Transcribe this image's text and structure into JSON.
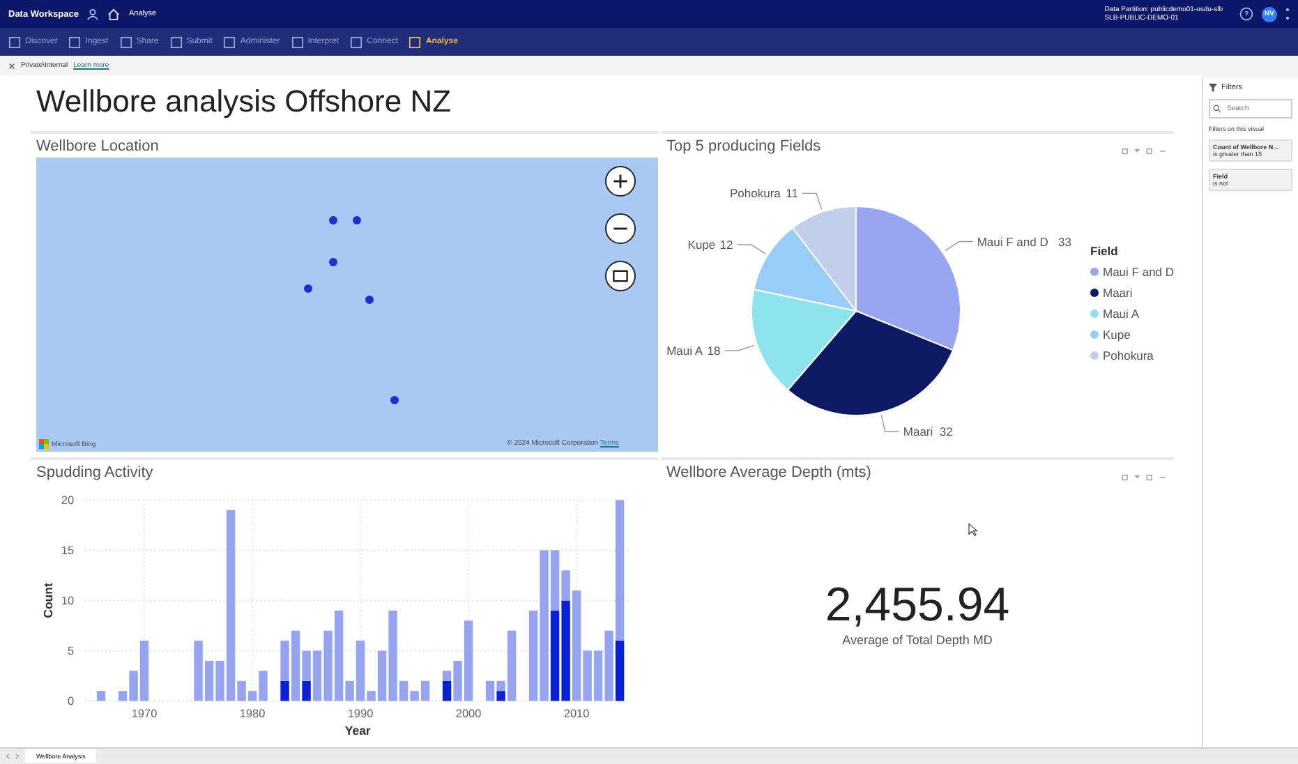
{
  "top_bar": {
    "app_title": "Data Workspace",
    "breadcrumb": "Analyse",
    "partition_line_1": "Data Partition: publicdemo01-osdu-slb",
    "partition_line_2": "SLB-PUBLIC-DEMO-01",
    "avatar_initials": "NV"
  },
  "nav": [
    {
      "label": "Discover",
      "selected": false
    },
    {
      "label": "Ingest",
      "selected": false
    },
    {
      "label": "Share",
      "selected": false
    },
    {
      "label": "Submit",
      "selected": false
    },
    {
      "label": "Administer",
      "selected": false
    },
    {
      "label": "Interpret",
      "selected": false
    },
    {
      "label": "Connect",
      "selected": false
    },
    {
      "label": "Analyse",
      "selected": true
    }
  ],
  "info_bar": {
    "label": "Private\\Internal",
    "link": "Learn more"
  },
  "report_title": "Wellbore analysis Offshore NZ",
  "map_tile": {
    "title": "Wellbore Location",
    "attribution": "Microsoft Bing",
    "copyright": "© 2024 Microsoft Corporation",
    "terms": "Terms"
  },
  "pie_tile": {
    "title": "Top 5 producing Fields",
    "legend_title": "Field",
    "legend": [
      {
        "label": "Maui F and D",
        "color": "#98a6f2"
      },
      {
        "label": "Maari",
        "color": "#0c1a63"
      },
      {
        "label": "Maui A",
        "color": "#8fe3ee"
      },
      {
        "label": "Kupe",
        "color": "#99cdf8"
      },
      {
        "label": "Pohokura",
        "color": "#c3cfea"
      }
    ],
    "chart_data": {
      "type": "pie",
      "categories": [
        "Maui F and D",
        "Maari",
        "Maui A",
        "Kupe",
        "Pohokura"
      ],
      "values": [
        33,
        32,
        18,
        12,
        11
      ],
      "data_labels": true
    }
  },
  "bar_tile": {
    "title": "Spudding Activity",
    "chart_data": {
      "type": "bar",
      "stacked": true,
      "xlabel": "Year",
      "ylabel": "Count",
      "x": [
        1966,
        1968,
        1969,
        1970,
        1975,
        1976,
        1977,
        1978,
        1979,
        1980,
        1981,
        1983,
        1984,
        1985,
        1986,
        1987,
        1988,
        1989,
        1990,
        1991,
        1992,
        1993,
        1994,
        1995,
        1996,
        1998,
        1999,
        2000,
        2002,
        2003,
        2004,
        2006,
        2007,
        2008,
        2009,
        2010,
        2011,
        2012,
        2013,
        2014
      ],
      "series": [
        {
          "color": "#0a1fd8",
          "values": [
            0,
            0,
            0,
            0,
            0,
            0,
            0,
            0,
            0,
            0,
            0,
            2,
            0,
            2,
            0,
            0,
            0,
            0,
            0,
            0,
            0,
            0,
            0,
            0,
            0,
            2,
            0,
            0,
            0,
            1,
            0,
            0,
            0,
            9,
            10,
            0,
            0,
            0,
            0,
            6
          ]
        },
        {
          "color": "#96a3f0",
          "values": [
            1,
            1,
            3,
            6,
            6,
            4,
            4,
            19,
            2,
            1,
            3,
            4,
            7,
            3,
            5,
            7,
            9,
            2,
            6,
            1,
            5,
            9,
            2,
            1,
            2,
            1,
            4,
            8,
            2,
            1,
            7,
            9,
            15,
            6,
            3,
            11,
            5,
            5,
            7,
            14
          ]
        }
      ],
      "xlim": [
        1964.5,
        2015
      ],
      "grid": true,
      "ylim": [
        0,
        20
      ],
      "yticks": [
        0,
        5,
        10,
        15,
        20
      ],
      "xticks": [
        1970,
        1980,
        1990,
        2000,
        2010
      ]
    }
  },
  "card_tile": {
    "title": "Wellbore Average Depth (mts)",
    "value": "2,455.94",
    "caption": "Average of Total Depth MD"
  },
  "filters": {
    "title": "Filters",
    "search_placeholder": "Search",
    "section": "Filters on this visual",
    "cards": [
      {
        "name": "Count of Wellbore N...",
        "condition": "is greater than 15"
      },
      {
        "name": "Field",
        "condition": "is not"
      }
    ]
  },
  "page_tabs": [
    {
      "label": "Wellbore Analysis",
      "selected": true
    }
  ]
}
